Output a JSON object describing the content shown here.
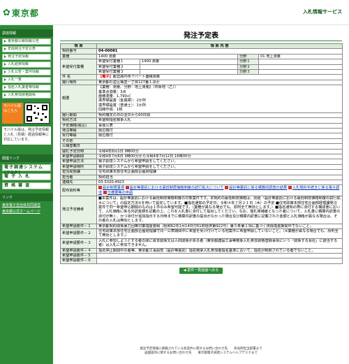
{
  "header": {
    "logo_text": "東京都",
    "right_label": "入札情報サービス"
  },
  "sidebar": {
    "section1": "調達情報",
    "items": [
      "東京都公報情報公告",
      "年間発注予定公表",
      "発注予定情報",
      "入札結果情報",
      "入札公告・案件情報",
      "入札一覧",
      "指名入札業者等情報",
      "入札参加資格関係"
    ],
    "mobile_label": "モバイル版はこちら",
    "note": "モバイル版は、発注予定情報と入札（見積）経過情報等に対応しています。",
    "section2": "関連リンク",
    "big_items": [
      "電子調達システム(TOP)",
      "電 子 入 札",
      "資 格 審 査"
    ],
    "section3": "リンク",
    "links": [
      "東京電子自治体共同運営",
      "東京都公式ホームページ"
    ]
  },
  "main": {
    "title": "発注予定表",
    "back_button": "◀ 案件一覧画面へ戻る"
  },
  "table": {
    "head_item": "項 目",
    "head_content": "項 目 内 容",
    "rows": {
      "contract_no_label": "契約番号",
      "contract_no": "04-00081",
      "industry_label": "業種",
      "industry": "1400 測量",
      "bunya_label": "分野",
      "bunya": "01 地上測量",
      "hope_label": "希望受付業種",
      "hope1_label": "希望受付業種１",
      "hope1_value": "1400 測量",
      "hope2_label": "希望受付業種２",
      "hope3_label": "希望受付業種３",
      "bunya1_label": "分野１",
      "bunya2_label": "分野２",
      "bunya3_label": "分野３",
      "kenmei_label": "件 名",
      "kenmei_tag": "【電子】",
      "kenmei": "都営高円寺アパート面積測量",
      "place_label": "履行場所",
      "place": "東京都杉並区梅里一丁目127番１ほか",
      "outline_label": "概要",
      "outline": [
        "【業種：測量、分野：地上測量】（市街地（乙））",
        "基準点測量：3点",
        "面積測量：1,790㎡",
        "境界標設置（金属標）：2か所",
        "境界標設置（普通土）：1か所",
        "回線作成：1枚"
      ],
      "period_label": "履行期間",
      "period": "契約確定の日の翌日から60日間",
      "method_label": "契約方法",
      "method": "希望制指名競争入札",
      "price_label": "予定価格(税込)",
      "price": "事後公表",
      "order_label": "発注等級",
      "order": "順位格付",
      "grade_label": "受付等級",
      "grade": "順位格付",
      "other_label": "その他",
      "other": "",
      "date_label": "公報登載日",
      "date": "",
      "open_label": "開札予定日時",
      "open": "令和4年8月1日 9時00分",
      "accept_label": "希望申請期間",
      "accept": "令和4年7月6日 9時00分から令和4年7月12日 16時00分",
      "apply_method_label": "希望申請方法",
      "apply_method": "電子調達システムから希望申請をしてください。",
      "submit_label": "希望申請場所",
      "submit": "電子調達システムから希望申請をしてください。",
      "dept_label": "担当局部課",
      "dept": "住宅政策本部住宅企画部企画経理課",
      "person_label": "担当者",
      "person": "契約担当",
      "tel_label": "連絡先",
      "tel": "03-5320-4923",
      "docs_label": "配布資料等",
      "docs": [
        "設計制限事項",
        "設計等委託における最低制限価格制度の試行拡大について",
        "設計等委託に係る積算的調査の結果",
        "入札契約手続きに係る電子調達",
        "仕様書等の申請"
      ],
      "notes_label": "発注予定備考",
      "notes": "■本案件は、設計等委託における最低制限価格制度の対象案件です。本契約の最低制限価格は、別紙「設計等委託における最低制限価格制度の試行拡大について」の設定方法③を用いて設定しています。■指名通知の予定日：令和４年７月２１日（木）の予定 ■住宅政策本部住宅企画部経理課発注案件で同一希望申込期間のものは１件のみ希望可能です。（業種が異なる場合でも、原則全て無効とします。）■指名通知の際に添付する構成書において、入札価格に係る内訳金額を記載の上、これを入札書に添付して提出してください。なお、落札候補者となった者について、入札書に積算内訳書の添付が無く、かつ添付が追加指示する日時までに積算内訳書の提出がなかった場合及び積算内訳書に記載された金額と入札価格が異なる場合は、その者の入札は無効とします。",
      "basis_label": "希望申請要件－１",
      "basis": "東京都契約関係暴力団等対策措置要綱（昭和62年1月14日付61財経庶第922号）第５条第１項に基づく排除措置期間中でないこと。",
      "req2_label": "希望申請要件－２",
      "req2": "住宅政策本部住宅企画部企画経理課で同一公表期間中に希望を受け付けている他案件に希望申請していないこと。（※業種が異なる場合でも、原則全て無効とします。）",
      "req3_label": "希望申請要件－３",
      "req3": "入札に参加しようとする者の間に資本関係又は人的関係がある者（東京都建設工事等競争入札参加資格登録事項にいう「関係する会社」に該当する者）は入札に参加できません。",
      "req4_label": "希望申請要件－４",
      "req4": "指名停止期間中の者等、東京都工事請負（設計等委託）指名競争入札参加者指名基準において、指名が制限されている者でないこと。",
      "req5_label": "希望申請要件－５",
      "req6_label": "希望申請要件－６"
    }
  },
  "footer": {
    "line1": "発注予定情報に掲載されている各案件に関するお問い合わせ先　　各局所担当部署まで",
    "line2": "画面操作に関するお問い合わせ先　　東京都電子調達システムヘルプデスクまで"
  }
}
